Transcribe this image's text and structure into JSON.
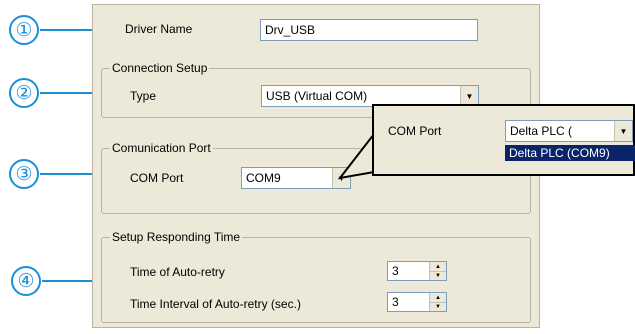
{
  "driver": {
    "label": "Driver Name",
    "value": "Drv_USB"
  },
  "connection": {
    "legend": "Connection Setup",
    "type_label": "Type",
    "type_value": "USB (Virtual COM)"
  },
  "comm": {
    "legend": "Comunication Port",
    "port_label": "COM Port",
    "port_value": "COM9"
  },
  "timing": {
    "legend": "Setup Responding Time",
    "retry_label": "Time of Auto-retry",
    "retry_value": "3",
    "interval_label": "Time Interval of Auto-retry (sec.)",
    "interval_value": "3"
  },
  "popup": {
    "label": "COM Port",
    "value": "Delta PLC (",
    "option": "Delta PLC (COM9)"
  },
  "callouts": [
    "①",
    "②",
    "③",
    "④"
  ],
  "colors": {
    "callout": "#1b8fd6",
    "dialog_bg": "#ece9d8",
    "selection": "#0a246a"
  },
  "icons": {
    "dropdown": "chevron-down-icon",
    "spin_up": "spin-up-icon",
    "spin_down": "spin-down-icon"
  }
}
